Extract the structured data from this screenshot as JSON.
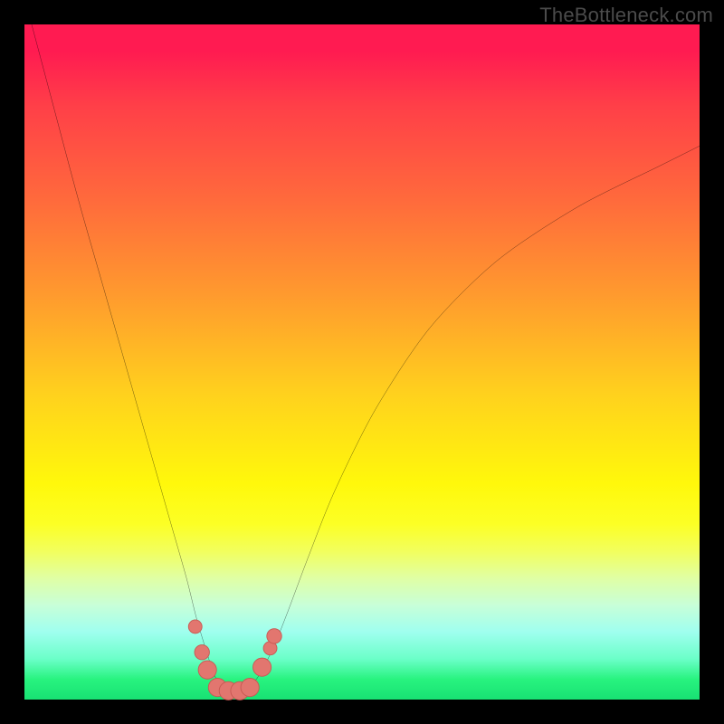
{
  "watermark": "TheBottleneck.com",
  "colors": {
    "frame": "#000000",
    "curve_stroke": "#000000",
    "marker_fill": "#e2766f",
    "marker_stroke": "#c75852"
  },
  "chart_data": {
    "type": "line",
    "title": "",
    "xlabel": "",
    "ylabel": "",
    "xlim": [
      0,
      100
    ],
    "ylim": [
      0,
      100
    ],
    "grid": false,
    "series": [
      {
        "name": "bottleneck-curve",
        "x": [
          0,
          4,
          8,
          12,
          16,
          20,
          22,
          24,
          25.5,
          27,
          28,
          29,
          30.5,
          32,
          33.5,
          35,
          37,
          39,
          42,
          46,
          52,
          60,
          70,
          82,
          94,
          100
        ],
        "y": [
          104,
          89,
          74,
          60,
          46,
          32,
          25,
          18,
          12,
          7,
          4,
          2,
          1.2,
          1.2,
          2,
          4,
          8,
          13,
          21,
          31,
          43,
          55,
          65,
          73,
          79,
          82
        ]
      }
    ],
    "markers": [
      {
        "x": 25.3,
        "y": 10.8,
        "r": 1.0
      },
      {
        "x": 26.3,
        "y": 7.0,
        "r": 1.1
      },
      {
        "x": 27.1,
        "y": 4.4,
        "r": 1.35
      },
      {
        "x": 28.6,
        "y": 1.8,
        "r": 1.35
      },
      {
        "x": 30.2,
        "y": 1.3,
        "r": 1.35
      },
      {
        "x": 31.9,
        "y": 1.3,
        "r": 1.35
      },
      {
        "x": 33.4,
        "y": 1.8,
        "r": 1.35
      },
      {
        "x": 35.2,
        "y": 4.8,
        "r": 1.35
      },
      {
        "x": 36.4,
        "y": 7.6,
        "r": 1.0
      },
      {
        "x": 37.0,
        "y": 9.4,
        "r": 1.1
      }
    ]
  }
}
